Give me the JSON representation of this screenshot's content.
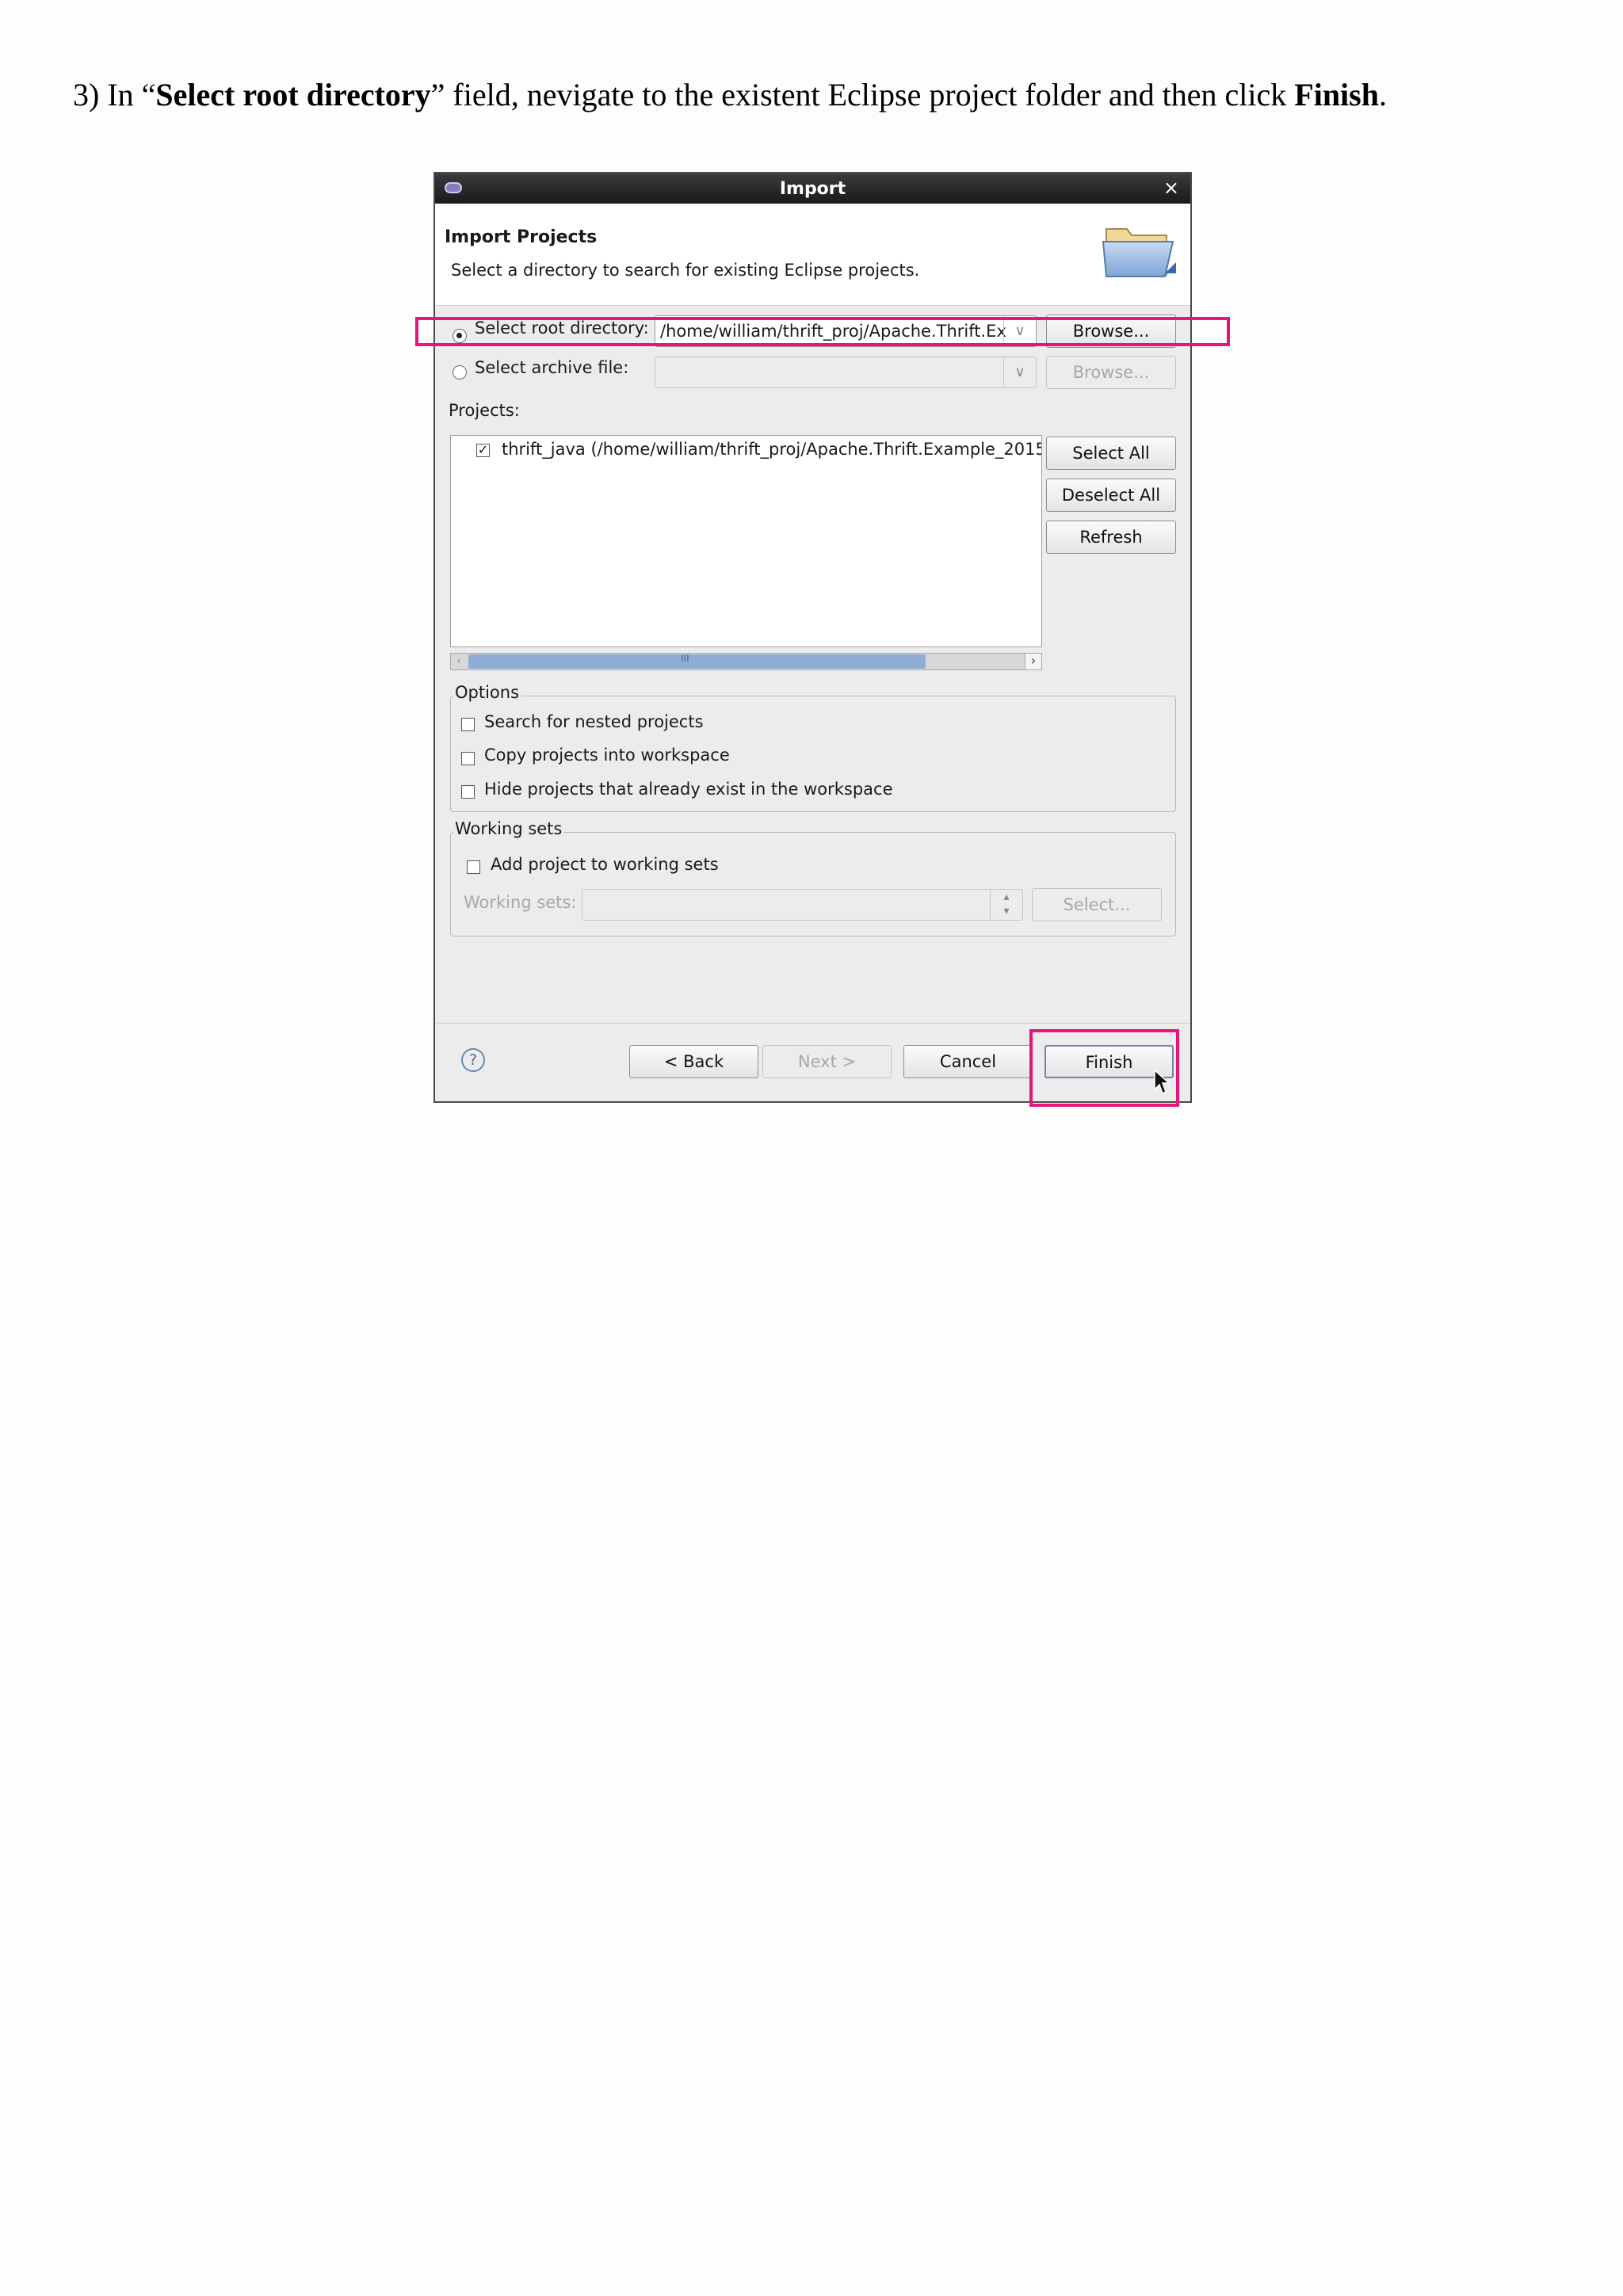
{
  "instruction": {
    "prefix": "3) In “",
    "bold1": "Select root directory",
    "middle": "” field, nevigate to the existent Eclipse project folder and then click ",
    "bold2": "Finish",
    "suffix": "."
  },
  "dialog": {
    "title": "Import",
    "close_glyph": "×",
    "header": {
      "title": "Import Projects",
      "description": "Select a directory to search for existing Eclipse projects.",
      "icon": "folder-icon"
    },
    "root_directory": {
      "label": "Select root directory:",
      "selected": true,
      "value": "/home/william/thrift_proj/Apache.Thrift.Ex",
      "browse_label": "Browse..."
    },
    "archive_file": {
      "label": "Select archive file:",
      "selected": false,
      "value": "",
      "browse_label": "Browse..."
    },
    "projects": {
      "label": "Projects:",
      "items": [
        {
          "label": "thrift_java (/home/william/thrift_proj/Apache.Thrift.Example_2015",
          "checked": true
        }
      ],
      "select_all": "Select All",
      "deselect_all": "Deselect All",
      "refresh": "Refresh",
      "scroll_grip": "III"
    },
    "options": {
      "title": "Options",
      "items": [
        {
          "label": "Search for nested projects",
          "checked": false
        },
        {
          "label": "Copy projects into workspace",
          "checked": false
        },
        {
          "label": "Hide projects that already exist in the workspace",
          "checked": false
        }
      ]
    },
    "working_sets": {
      "title": "Working sets",
      "add_label": "Add project to working sets",
      "add_checked": false,
      "sets_label": "Working sets:",
      "select_label": "Select..."
    },
    "footer": {
      "help_glyph": "?",
      "back": "< Back",
      "next": "Next >",
      "cancel": "Cancel",
      "finish": "Finish"
    }
  },
  "colors": {
    "highlight": "#e6157a",
    "title_bar": "#1a1a1a",
    "dialog_bg": "#ececec"
  }
}
